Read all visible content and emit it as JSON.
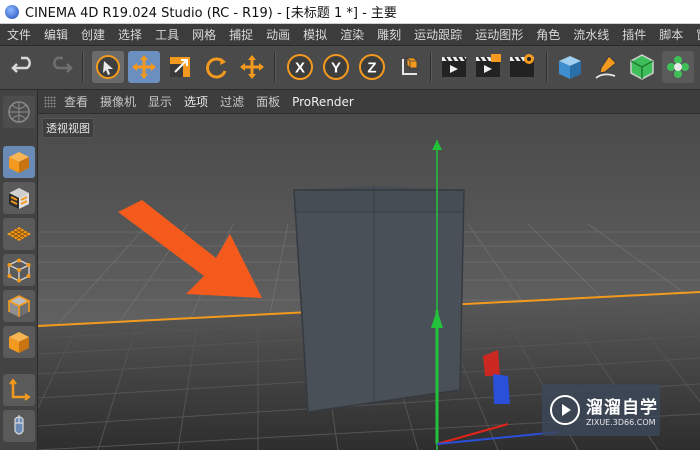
{
  "window": {
    "title": "CINEMA 4D R19.024 Studio (RC - R19) - [未标题 1 *] - 主要"
  },
  "menubar": {
    "items": [
      "文件",
      "编辑",
      "创建",
      "选择",
      "工具",
      "网格",
      "捕捉",
      "动画",
      "模拟",
      "渲染",
      "雕刻",
      "运动跟踪",
      "运动图形",
      "角色",
      "流水线",
      "插件",
      "脚本",
      "窗口"
    ]
  },
  "toolbar": {
    "buttons": [
      {
        "icon": "undo-icon"
      },
      {
        "icon": "redo-icon"
      },
      {
        "icon": "live-select-icon"
      },
      {
        "icon": "move-icon"
      },
      {
        "icon": "scale-icon"
      },
      {
        "icon": "rotate-icon"
      },
      {
        "icon": "recent-tool-icon"
      },
      {
        "icon": "x-axis-lock-icon",
        "label": "X"
      },
      {
        "icon": "y-axis-lock-icon",
        "label": "Y"
      },
      {
        "icon": "z-axis-lock-icon",
        "label": "Z"
      },
      {
        "icon": "coordinate-system-icon"
      },
      {
        "icon": "render-view-icon"
      },
      {
        "icon": "render-to-picture-viewer-icon"
      },
      {
        "icon": "render-settings-icon"
      },
      {
        "icon": "cube-object-icon"
      },
      {
        "icon": "pen-spline-icon"
      },
      {
        "icon": "subdivision-surface-icon"
      },
      {
        "icon": "cloner-icon"
      }
    ]
  },
  "leftpalette": {
    "buttons": [
      "make-editable-icon",
      "model-mode-icon",
      "texture-mode-icon",
      "workplane-icon",
      "points-mode-icon",
      "edges-mode-icon",
      "polygons-mode-icon",
      "enable-axis-icon",
      "tweak-mode-icon"
    ]
  },
  "viewport": {
    "menu": [
      "查看",
      "摄像机",
      "显示",
      "选项",
      "过滤",
      "面板",
      "ProRender"
    ],
    "label": "透视视图"
  },
  "colors": {
    "accent_orange": "#f39a1e",
    "axis_y": "#22c33a",
    "axis_x": "#e2231a",
    "axis_z": "#2a4fd8",
    "arrow": "#f45a1c"
  },
  "watermark": {
    "name": "溜溜自学",
    "url": "ZIXUE.3D66.COM"
  }
}
